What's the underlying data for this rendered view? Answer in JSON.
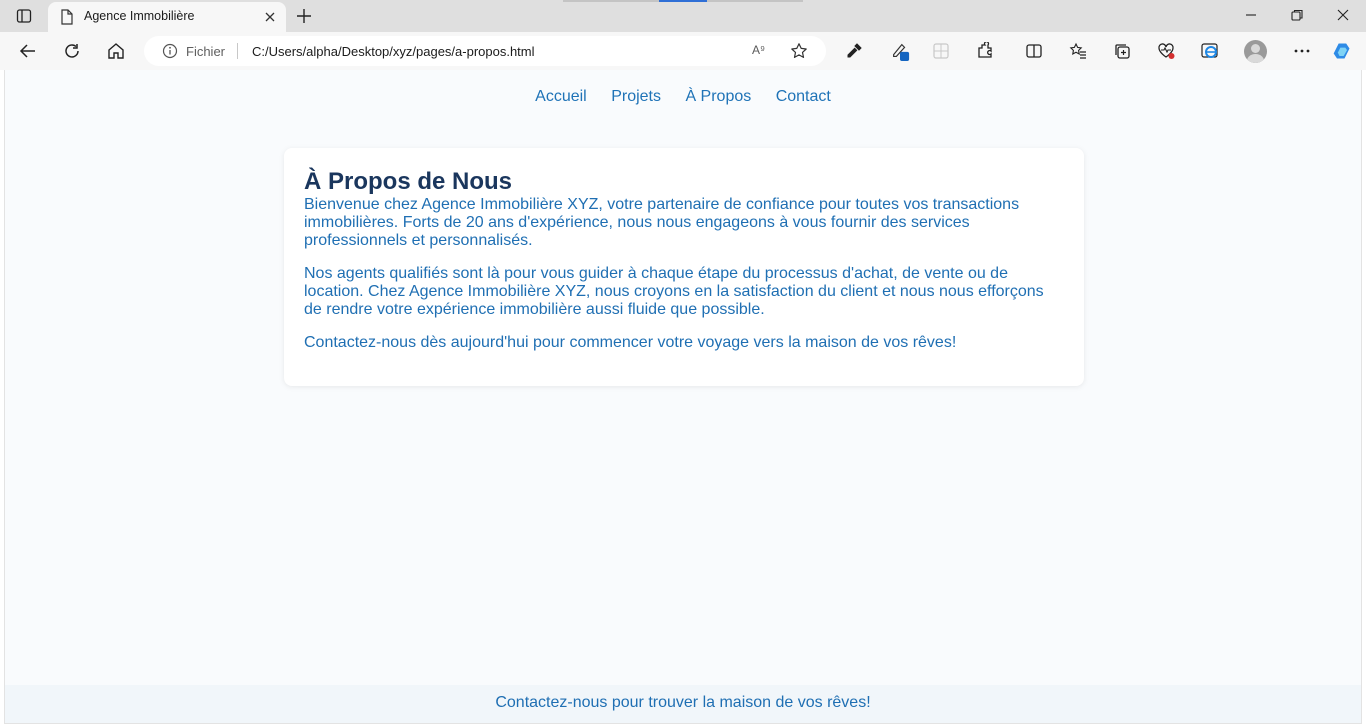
{
  "browser": {
    "tab": {
      "title": "Agence Immobilière"
    },
    "address": {
      "security_label": "Fichier",
      "url": "C:/Users/alpha/Desktop/xyz/pages/a-propos.html",
      "read_aloud_glyph": "A⁹"
    },
    "icons": [
      "tab-actions-icon",
      "page-icon",
      "close-icon",
      "plus-icon",
      "minimize-icon",
      "restore-icon",
      "window-close-icon",
      "back-icon",
      "refresh-icon",
      "home-icon",
      "info-icon",
      "favorite-star-icon",
      "eyedropper-icon",
      "pen-icon",
      "grid-icon",
      "extensions-icon",
      "split-screen-icon",
      "favorites-icon",
      "collections-icon",
      "performance-icon",
      "internet-explorer-icon",
      "profile-icon",
      "more-icon",
      "copilot-icon"
    ],
    "accent_color": "#2f6fd6"
  },
  "site": {
    "nav": [
      "Accueil",
      "Projets",
      "À Propos",
      "Contact"
    ],
    "heading": "À Propos de Nous",
    "paragraphs": [
      "Bienvenue chez Agence Immobilière XYZ, votre partenaire de confiance pour toutes vos transactions immobilières. Forts de 20 ans d'expérience, nous nous engageons à vous fournir des services professionnels et personnalisés.",
      "Nos agents qualifiés sont là pour vous guider à chaque étape du processus d'achat, de vente ou de location. Chez Agence Immobilière XYZ, nous croyons en la satisfaction du client et nous nous efforçons de rendre votre expérience immobilière aussi fluide que possible.",
      "Contactez-nous dès aujourd'hui pour commencer votre voyage vers la maison de vos rêves!"
    ],
    "footer": "Contactez-nous pour trouver la maison de vos rêves!",
    "colors": {
      "heading": "#1a365d",
      "link": "#1f73b7",
      "text": "#1f6fb3",
      "background": "#f9fbfd"
    }
  }
}
